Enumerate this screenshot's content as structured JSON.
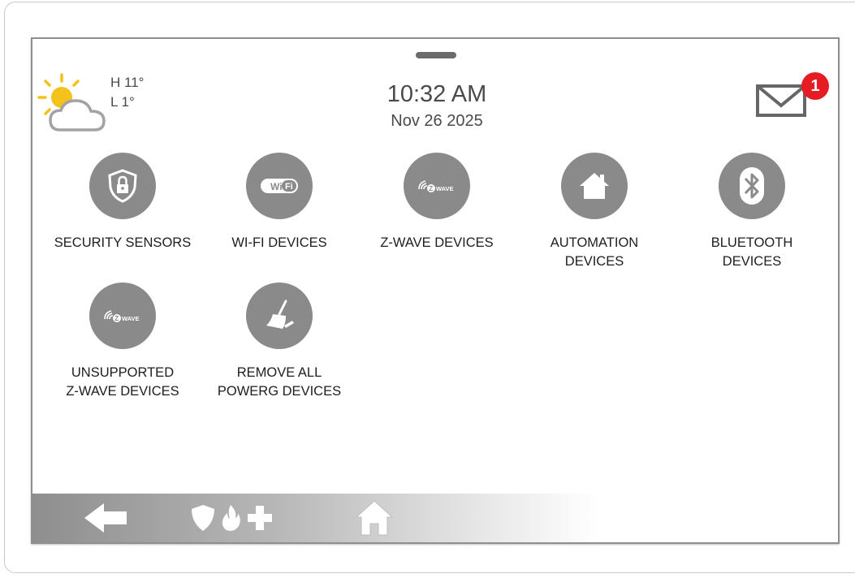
{
  "weather": {
    "icon": "partly-cloudy-icon",
    "high": "H 11°",
    "low": "L 1°"
  },
  "clock": {
    "time": "10:32 AM",
    "date": "Nov 26 2025"
  },
  "messages": {
    "icon": "envelope-icon",
    "badge_count": "1",
    "badge_color": "#e51c23"
  },
  "tiles": [
    {
      "label": "SECURITY SENSORS",
      "icon": "shield-lock-icon"
    },
    {
      "label": "WI-FI DEVICES",
      "icon": "wifi-icon"
    },
    {
      "label": "Z-WAVE DEVICES",
      "icon": "zwave-icon"
    },
    {
      "label": "AUTOMATION\nDEVICES",
      "icon": "house-icon"
    },
    {
      "label": "BLUETOOTH\nDEVICES",
      "icon": "bluetooth-icon"
    },
    {
      "label": "UNSUPPORTED\nZ-WAVE DEVICES",
      "icon": "zwave-icon"
    },
    {
      "label": "REMOVE ALL\nPOWERG DEVICES",
      "icon": "broom-icon"
    }
  ],
  "bottom_bar": {
    "back_icon": "back-arrow-icon",
    "emergency_icons": [
      "shield-icon",
      "fire-icon",
      "medical-cross-icon"
    ],
    "home_icon": "home-icon"
  },
  "colors": {
    "tile_circle": "#8a8a8a",
    "text": "#1e1e1e",
    "frame_border": "#8f8f8f"
  }
}
